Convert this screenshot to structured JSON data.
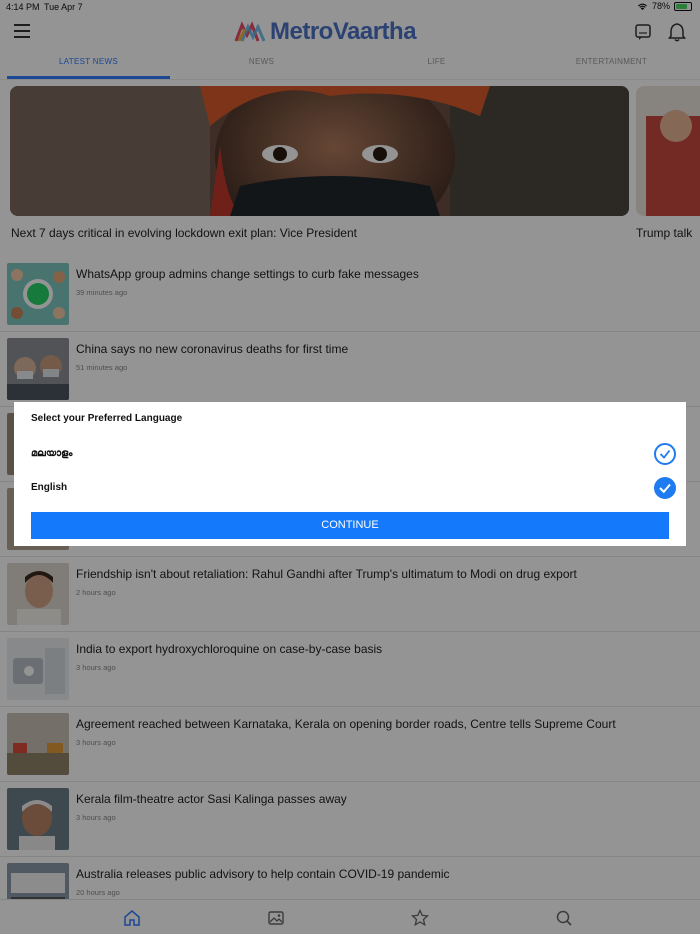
{
  "status_bar": {
    "time": "4:14 PM",
    "date": "Tue Apr 7",
    "battery": "78%"
  },
  "header": {
    "logo_text": "MetroVaartha"
  },
  "tabs": [
    {
      "label": "LATEST NEWS",
      "active": true
    },
    {
      "label": "NEWS",
      "active": false
    },
    {
      "label": "LIFE",
      "active": false
    },
    {
      "label": "ENTERTAINMENT",
      "active": false
    }
  ],
  "carousel": [
    {
      "caption": "Next 7 days critical in evolving lockdown exit plan: Vice President"
    },
    {
      "caption": "Trump talk"
    }
  ],
  "news": [
    {
      "title": "WhatsApp group admins change settings to curb fake messages",
      "time": "39 minutes ago"
    },
    {
      "title": "China says no new coronavirus deaths for first time",
      "time": "51 minutes ago"
    },
    {
      "title": "",
      "time": ""
    },
    {
      "title": "",
      "time": ""
    },
    {
      "title": "Friendship isn't about retaliation: Rahul Gandhi after Trump's ultimatum to Modi on drug export",
      "time": "2 hours ago"
    },
    {
      "title": "India to export hydroxychloroquine on case-by-case basis",
      "time": "3 hours ago"
    },
    {
      "title": "Agreement reached between Karnataka, Kerala on opening border roads, Centre tells Supreme Court",
      "time": "3 hours ago"
    },
    {
      "title": "Kerala film-theatre actor Sasi Kalinga passes away",
      "time": "3 hours ago"
    },
    {
      "title": "Australia releases public advisory to help contain COVID-19 pandemic",
      "time": "20 hours ago"
    }
  ],
  "bottom_nav": [
    {
      "icon": "home-icon",
      "active": true
    },
    {
      "icon": "gallery-icon",
      "active": false
    },
    {
      "icon": "star-icon",
      "active": false
    },
    {
      "icon": "search-icon",
      "active": false
    }
  ],
  "dialog": {
    "title": "Select your Preferred Language",
    "options": [
      {
        "label": "മലയാളം",
        "selected": false
      },
      {
        "label": "English",
        "selected": true
      }
    ],
    "continue_label": "CONTINUE"
  },
  "colors": {
    "accent": "#1479fb",
    "logo": "#4a73c7"
  }
}
